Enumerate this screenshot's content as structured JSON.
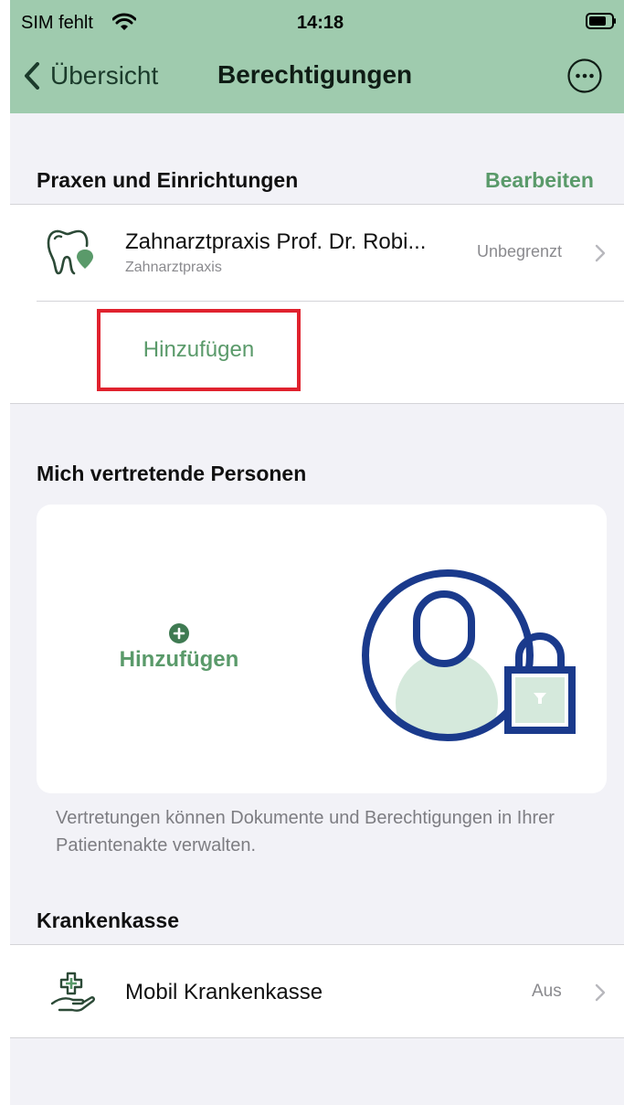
{
  "status_bar": {
    "carrier": "SIM fehlt",
    "time": "14:18",
    "icons": [
      "wifi-icon",
      "battery-icon"
    ]
  },
  "nav": {
    "back_label": "Übersicht",
    "title": "Berechtigungen",
    "more_icon": "more-circle-icon"
  },
  "praxen": {
    "header": "Praxen und Einrichtungen",
    "edit_label": "Bearbeiten",
    "items": [
      {
        "icon": "tooth-icon",
        "name": "Zahnarztpraxis Prof. Dr. Robi...",
        "type": "Zahnarztpraxis",
        "duration": "Unbegrenzt"
      }
    ],
    "add_label": "Hinzufügen"
  },
  "vertreter": {
    "header": "Mich vertretende Personen",
    "add_label": "Hinzufügen",
    "illustration": "person-lock-icon",
    "note": "Vertretungen können Dokumente und Berechtigungen in Ihrer Patientenakte verwalten."
  },
  "krankenkasse": {
    "header": "Krankenkasse",
    "items": [
      {
        "icon": "hand-cross-icon",
        "name": "Mobil Krankenkasse",
        "status": "Aus"
      }
    ]
  },
  "colors": {
    "nav_bar": "#9fcbae",
    "accent_green": "#5a9a6a",
    "highlight_red": "#e0222e",
    "illustration_blue": "#1a3a8c",
    "background": "#f2f2f7"
  }
}
